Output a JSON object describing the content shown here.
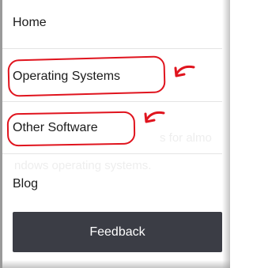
{
  "nav": {
    "items": [
      {
        "label": "Home"
      },
      {
        "label": "Operating Systems"
      },
      {
        "label": "Other Software"
      },
      {
        "label": "Blog"
      }
    ]
  },
  "background_text": {
    "line1": "s for almo",
    "line2": "ndows operating systems."
  },
  "feedback": {
    "label": "Feedback"
  },
  "colors": {
    "annotation_red": "#e0141e",
    "button_bg": "#3b3d45",
    "button_text": "#ffffff",
    "divider": "#e4e4e4"
  },
  "icons": [
    "red-arrow-annotation-icon"
  ]
}
